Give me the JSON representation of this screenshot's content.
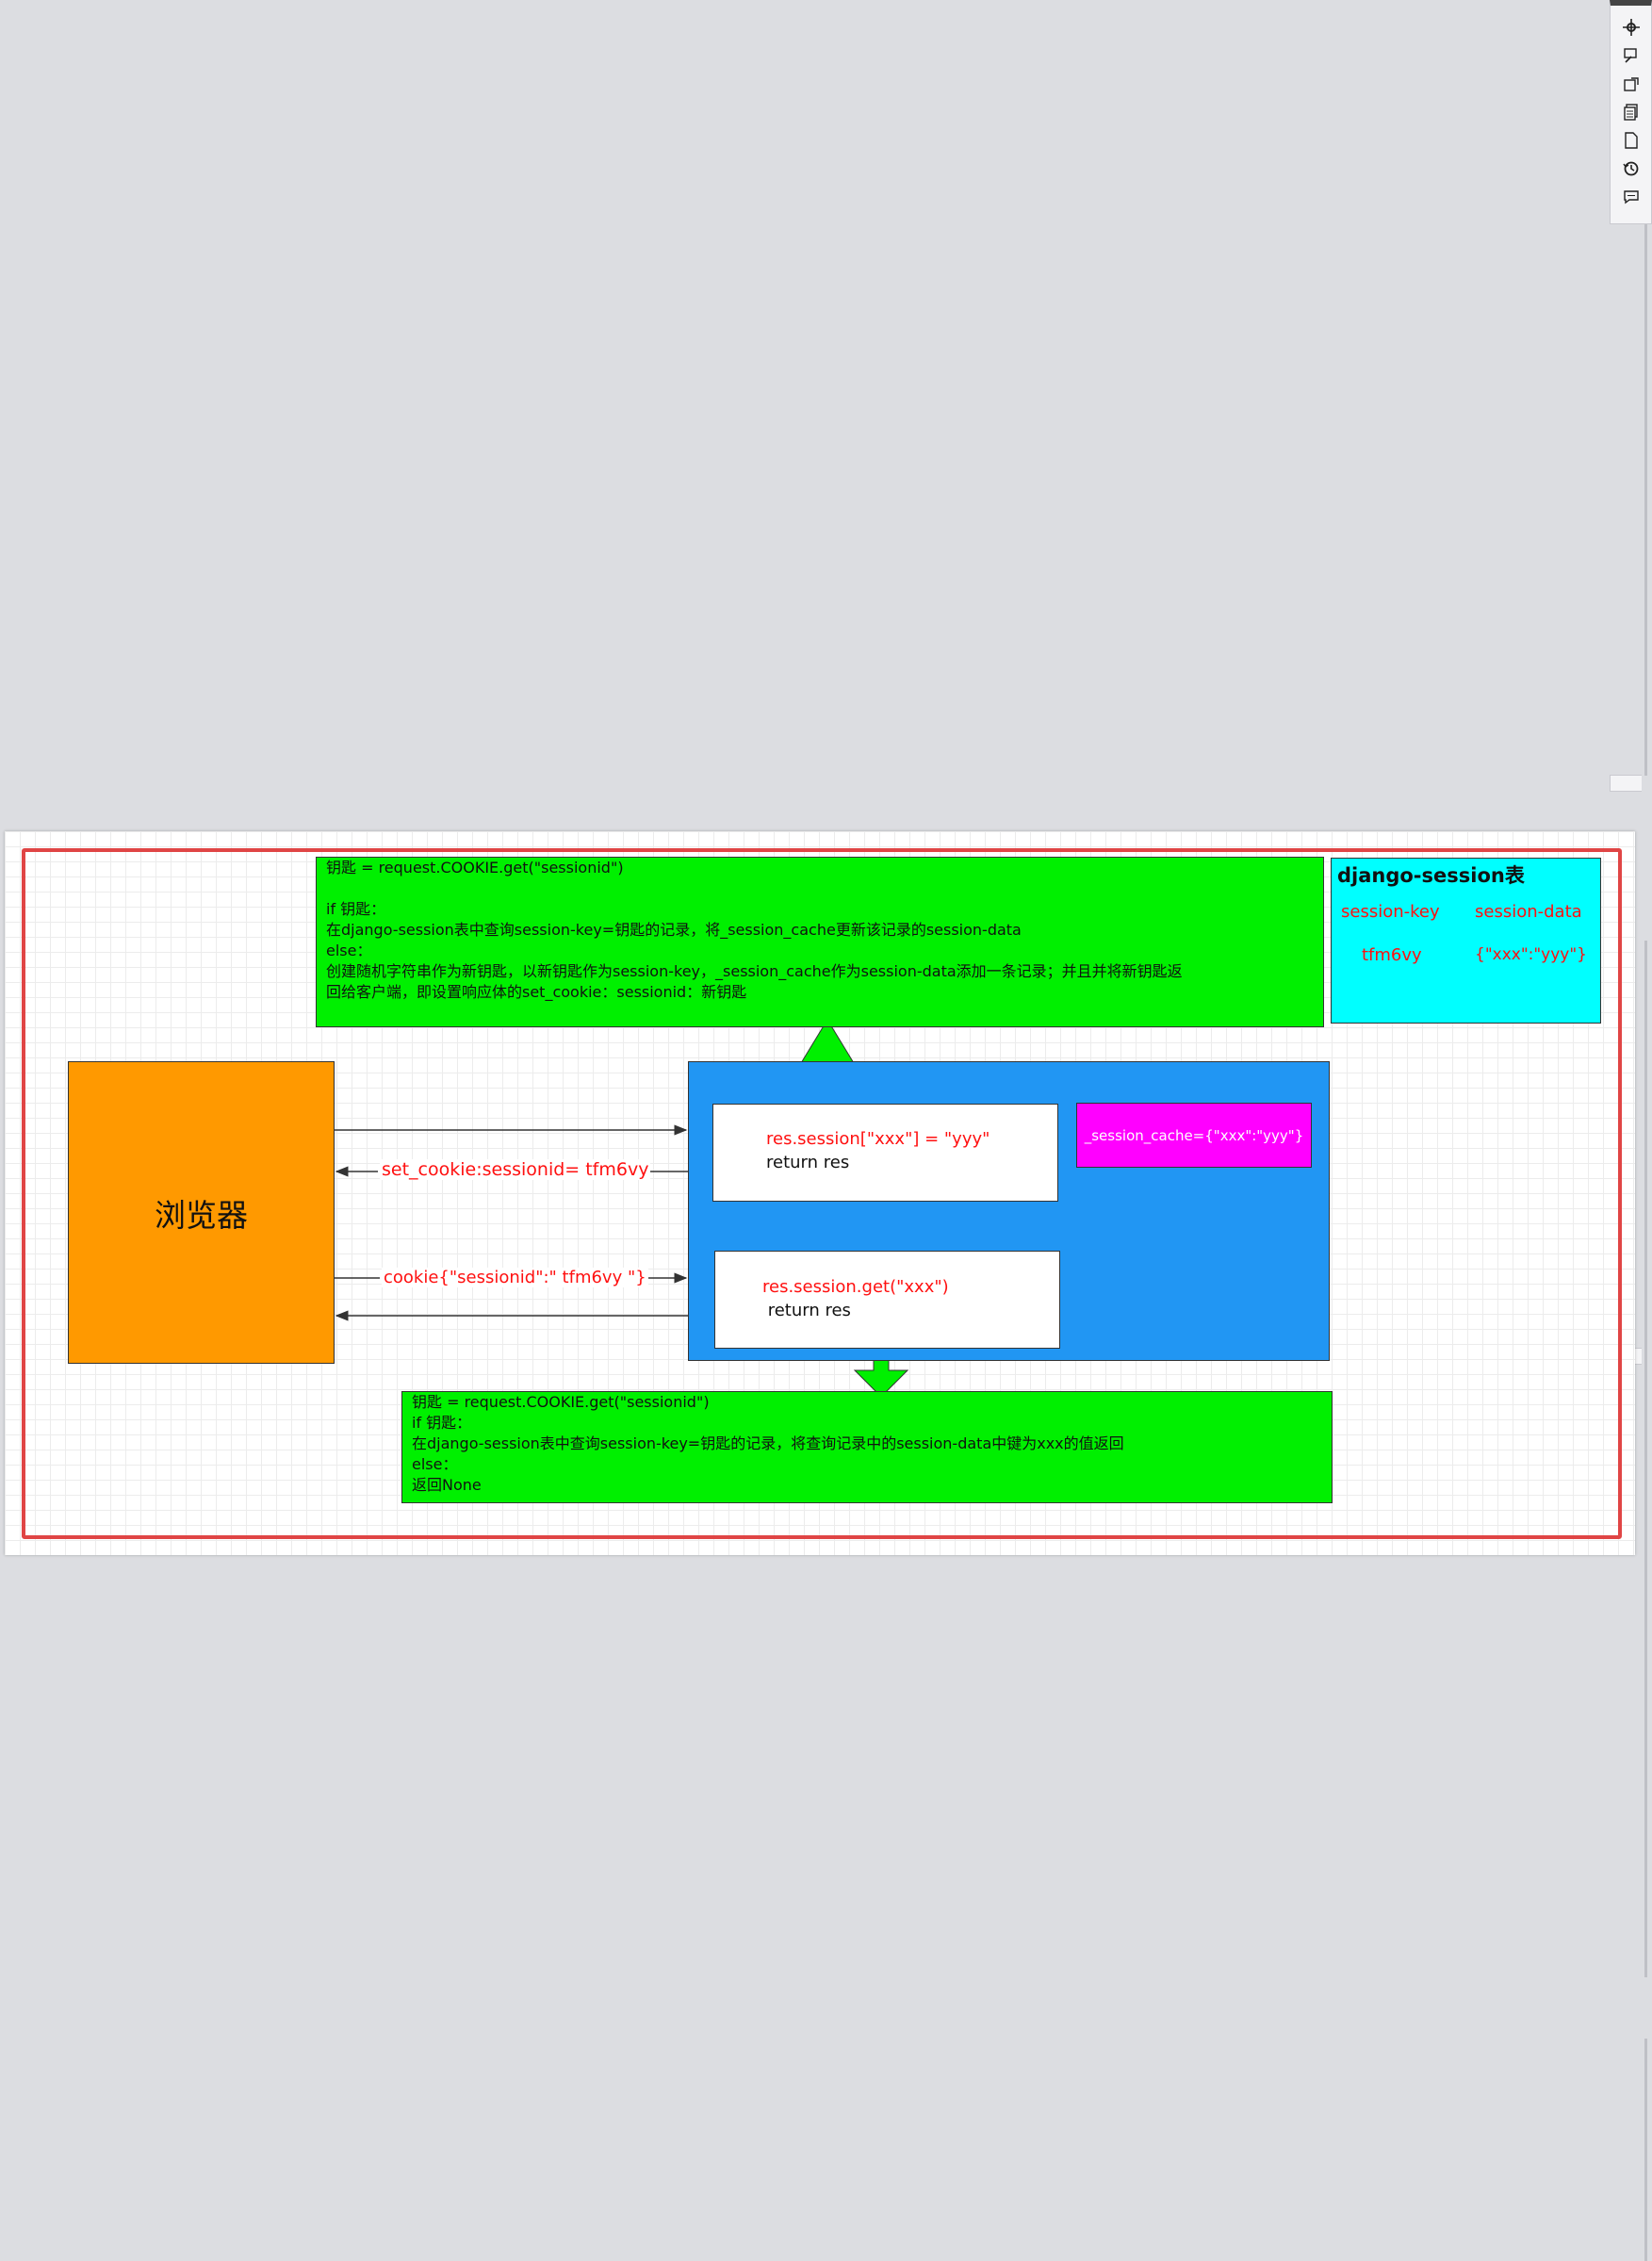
{
  "toolbar": {
    "icons": [
      "crosshair-icon",
      "format-icon",
      "export-icon",
      "pages-icon",
      "page-icon",
      "history-icon",
      "comment-icon"
    ]
  },
  "diagram": {
    "top_note": {
      "line1": " 钥匙 = request.COOKIE.get(\"sessionid\")",
      "line2": " if 钥匙：",
      "line3": "        在django-session表中查询session-key=钥匙的记录，将_session_cache更新该记录的session-data",
      "line4": "else：",
      "line5": "        创建随机字符串作为新钥匙，以新钥匙作为session-key，_session_cache作为session-data添加一条记录；并且并将新钥匙返",
      "line6": "回给客户端，即设置响应体的set_cookie：sessionid：新钥匙"
    },
    "browser_label": "浏览器",
    "set_box": {
      "line1": "res.session[\"xxx\"] = \"yyy\"",
      "line2": "return res"
    },
    "get_box": {
      "line1": "res.session.get(\"xxx\")",
      "line2": " return res"
    },
    "session_cache": "_session_cache={\"xxx\":\"yyy\"}",
    "edge_set_cookie": "set_cookie:sessionid= tfm6vy",
    "edge_cookie": "cookie{\"sessionid\":\" tfm6vy \"}",
    "table": {
      "title": "django-session表",
      "col1": "session-key",
      "col2": "session-data",
      "val1": "tfm6vy",
      "val2": "{\"xxx\":\"yyy\"}"
    },
    "bottom_note": {
      "line1": " 钥匙 = request.COOKIE.get(\"sessionid\")",
      "line2": " if 钥匙：",
      "line3": "        在django-session表中查询session-key=钥匙的记录，将查询记录中的session-data中键为xxx的值返回",
      "line4": "else：",
      "line5": "        返回None"
    },
    "colors": {
      "green": "#00f000",
      "orange": "#ff9900",
      "blue": "#2196f3",
      "magenta": "#ff00ff",
      "cyan": "#00ffff",
      "frame": "#e04545",
      "text_red": "#ff1010"
    }
  }
}
